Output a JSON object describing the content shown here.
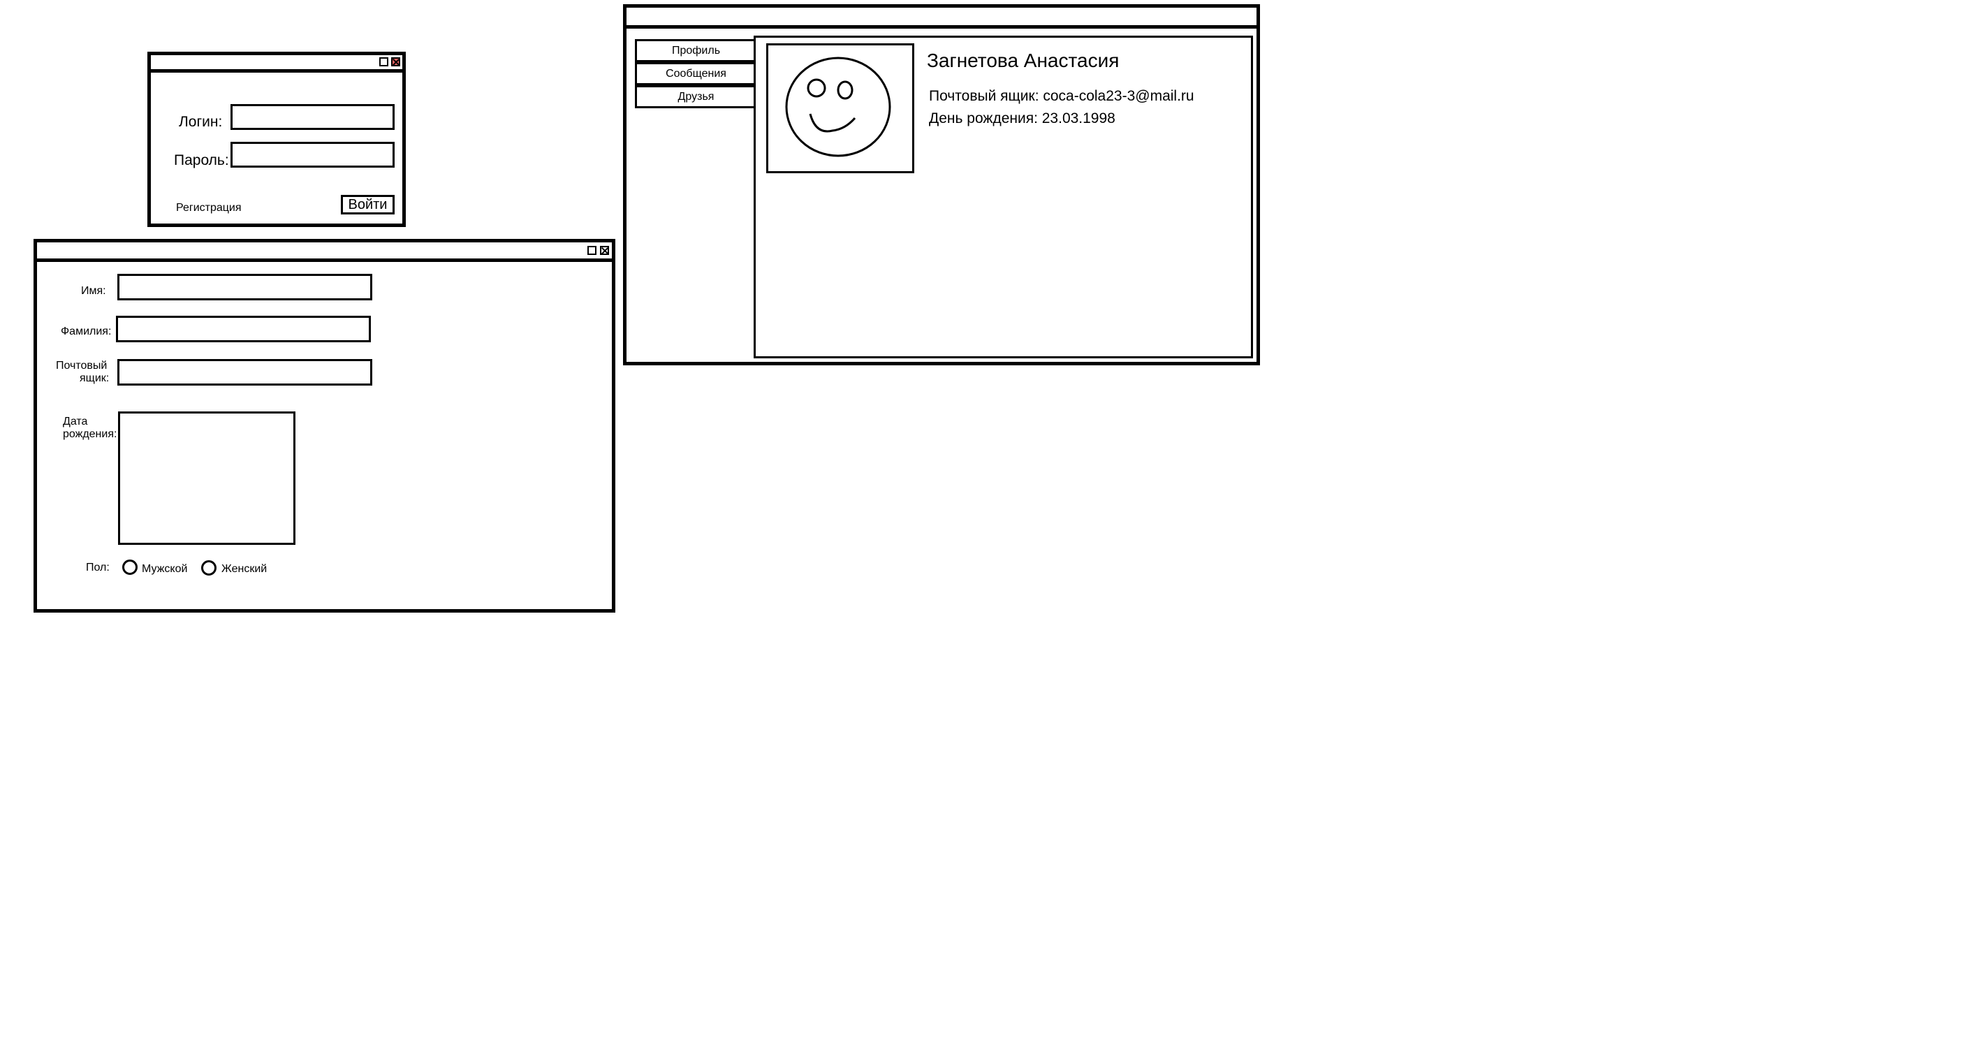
{
  "login": {
    "login_label": "Логин:",
    "password_label": "Пароль:",
    "register_link": "Регистрация",
    "submit_button": "Войти"
  },
  "register": {
    "name_label": "Имя:",
    "surname_label": "Фамилия:",
    "email_label_line1": "Почтовый",
    "email_label_line2": "ящик:",
    "birth_label_line1": "Дата",
    "birth_label_line2": "рождения:",
    "gender_label": "Пол:",
    "gender_options": [
      "Мужской",
      "Женский"
    ]
  },
  "profile": {
    "menu": [
      "Профиль",
      "Сообщения",
      "Друзья"
    ],
    "name": "Загнетова Анастасия",
    "email_line": "Почтовый ящик: coca-cola23-3@mail.ru",
    "birthday_line": "День рождения: 23.03.1998"
  },
  "icons": {
    "avatar": "smiley-face-icon",
    "maximize": "maximize-icon",
    "close": "close-icon",
    "radio": "radio-icon"
  }
}
